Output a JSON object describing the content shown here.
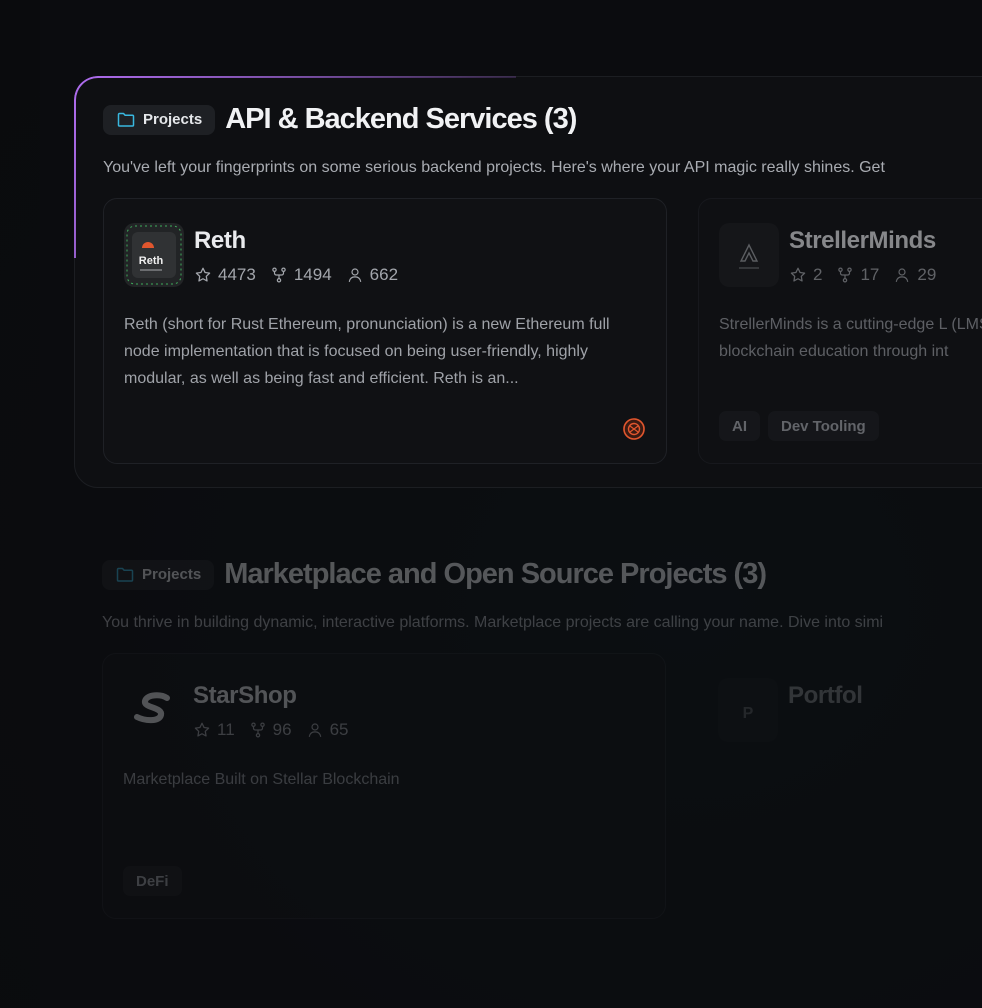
{
  "sections": [
    {
      "chip_label": "Projects",
      "title": "API & Backend Services (3)",
      "description": "You've left your fingerprints on some serious backend projects. Here's where your API magic really shines. Get",
      "cards": [
        {
          "name": "Reth",
          "logo_text": "Reth",
          "stars": "4473",
          "forks": "1494",
          "contributors": "662",
          "description": "Reth (short for Rust Ethereum, pronunciation) is a new Ethereum full node implementation that is focused on being user-friendly, highly modular, as well as being fast and efficient. Reth is an...",
          "tags": []
        },
        {
          "name": "StrellerMinds",
          "stars": "2",
          "forks": "17",
          "contributors": "29",
          "description": "StrellerMinds is a cutting-edge L (LMS) built on Stellar, designed to blockchain education through int",
          "tags": [
            "AI",
            "Dev Tooling"
          ]
        }
      ]
    },
    {
      "chip_label": "Projects",
      "title": "Marketplace and Open Source Projects (3)",
      "description": "You thrive in building dynamic, interactive platforms. Marketplace projects are calling your name. Dive into simi",
      "cards": [
        {
          "name": "StarShop",
          "stars": "11",
          "forks": "96",
          "contributors": "65",
          "description": "Marketplace Built on Stellar Blockchain",
          "tags": [
            "DeFi"
          ]
        },
        {
          "name": "Portfol",
          "logo_text": "P"
        }
      ]
    }
  ],
  "colors": {
    "accent_purple": "#b06df0",
    "folder_cyan": "#39b8e0",
    "owner_orange": "#e0562e"
  },
  "icons": [
    "folder-icon",
    "star-icon",
    "fork-icon",
    "user-icon",
    "owner-avatar-icon"
  ]
}
